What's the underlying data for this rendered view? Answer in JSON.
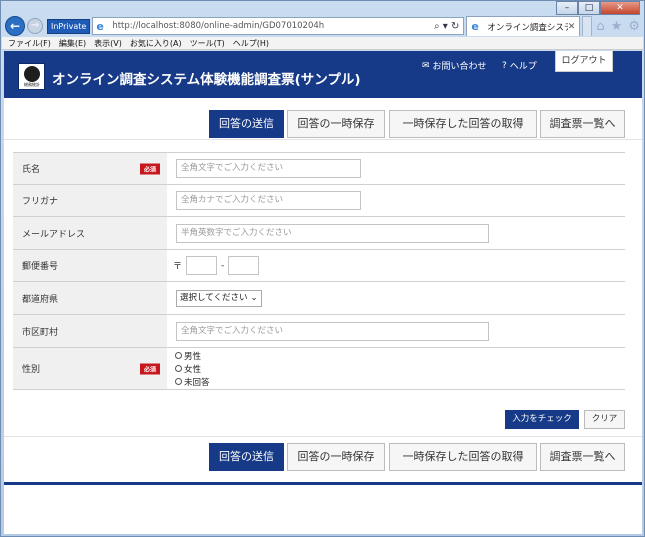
{
  "browser": {
    "address": "http://localhost:8080/online-admin/GD07010204h",
    "inprivate_label": "InPrivate",
    "tab_title": "オンライン調査システ...",
    "menu": [
      "ファイル(F)",
      "編集(E)",
      "表示(V)",
      "お気に入り(A)",
      "ツール(T)",
      "ヘルプ(H)"
    ]
  },
  "header": {
    "title": "オンライン調査システム体験機能調査票(サンプル)",
    "logo_text": "総務統計",
    "contact_label": "お問い合わせ",
    "help_label": "ヘルプ",
    "logout_label": "ログアウト",
    "color": "#163a87"
  },
  "actions": {
    "submit": "回答の送信",
    "temp_save": "回答の一時保存",
    "load_saved": "一時保存した回答の取得",
    "list": "調査票一覧へ"
  },
  "form": {
    "required_badge": "必須",
    "name": {
      "label": "氏名",
      "placeholder": "全角文字でご入力ください"
    },
    "furigana": {
      "label": "フリガナ",
      "placeholder": "全角カナでご入力ください"
    },
    "email": {
      "label": "メールアドレス",
      "placeholder": "半角英数字でご入力ください"
    },
    "postal": {
      "label": "郵便番号",
      "prefix": "〒",
      "separator": "-"
    },
    "prefecture": {
      "label": "都道府県",
      "selected": "選択してください"
    },
    "city": {
      "label": "市区町村",
      "placeholder": "全角文字でご入力ください"
    },
    "gender": {
      "label": "性別",
      "options": [
        "男性",
        "女性",
        "未回答"
      ]
    }
  },
  "check": {
    "check_label": "入力をチェック",
    "clear_label": "クリア"
  }
}
